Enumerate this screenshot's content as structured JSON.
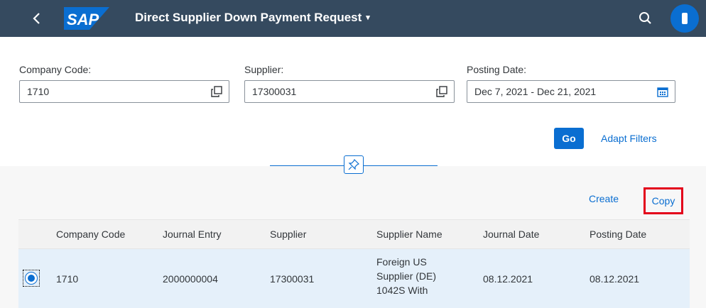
{
  "shell": {
    "logo_text": "SAP",
    "app_title": "Direct Supplier Down Payment Request",
    "title_caret": "▾",
    "colors": {
      "shell_bg": "#354a5f",
      "accent": "#0a6ed1",
      "highlight_box": "#e3001b"
    }
  },
  "filters": {
    "company_code": {
      "label": "Company Code:",
      "value": "1710"
    },
    "supplier": {
      "label": "Supplier:",
      "value": "17300031"
    },
    "posting_date": {
      "label": "Posting Date:",
      "value": "Dec 7, 2021 - Dec 21, 2021"
    },
    "go_label": "Go",
    "adapt_filters_label": "Adapt Filters"
  },
  "toolbar": {
    "create_label": "Create",
    "copy_label": "Copy"
  },
  "table": {
    "columns": [
      "Company Code",
      "Journal Entry",
      "Supplier",
      "Supplier Name",
      "Journal Date",
      "Posting Date"
    ],
    "rows": [
      {
        "company_code": "1710",
        "journal_entry": "2000000004",
        "supplier": "17300031",
        "supplier_name_lines": [
          "Foreign US",
          "Supplier (DE)",
          "1042S With"
        ],
        "journal_date": "08.12.2021",
        "posting_date": "08.12.2021",
        "selected": true
      }
    ]
  }
}
